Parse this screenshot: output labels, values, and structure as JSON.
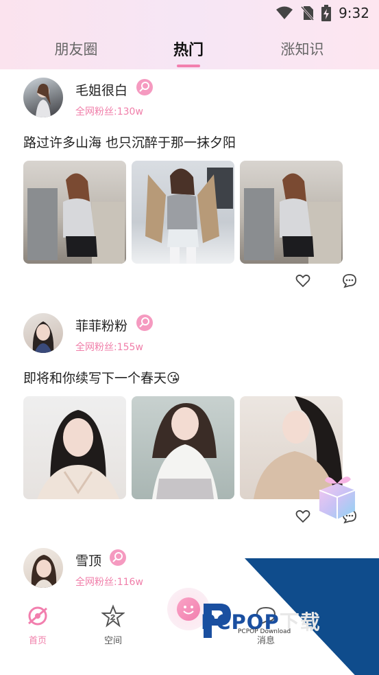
{
  "status_bar": {
    "time": "9:32"
  },
  "tabs": [
    {
      "label": "朋友圈"
    },
    {
      "label": "热门"
    },
    {
      "label": "涨知识"
    }
  ],
  "posts": [
    {
      "author": "毛姐很白",
      "fans": "全网粉丝:130w",
      "caption": "路过许多山海 也只沉醉于那一抹夕阳"
    },
    {
      "author": "菲菲粉粉",
      "fans": "全网粉丝:155w",
      "caption": "即将和你续写下一个春天😘"
    },
    {
      "author": "雪顶",
      "fans": "全网粉丝:116w",
      "caption": ""
    }
  ],
  "bottom_nav": [
    {
      "label": "首页",
      "icon": "home-icon"
    },
    {
      "label": "空间",
      "icon": "star-icon"
    },
    {
      "label": "消息",
      "icon": "message-icon"
    }
  ],
  "watermark": {
    "brand": "PCPOP",
    "suffix": "下载",
    "sub": "PCPOP Download"
  },
  "colors": {
    "accent": "#f27fae",
    "fans_text": "#f07ea9",
    "watermark_blue": "#0f4c8c"
  }
}
